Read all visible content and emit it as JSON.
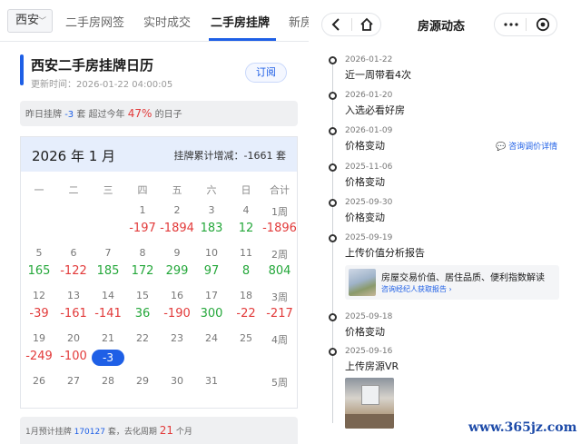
{
  "left": {
    "city": "西安",
    "nav_tabs": [
      "二手房网签",
      "实时成交",
      "二手房挂牌",
      "新房"
    ],
    "active_tab": "二手房挂牌",
    "page_title": "西安二手房挂牌日历",
    "update_time": "更新时间：2026-01-22 04:00:05",
    "subscribe_label": "订阅",
    "yesterday": {
      "prefix": "昨日挂牌",
      "value": "-3",
      "mid": "套 超过今年",
      "percent": "47%",
      "suffix": "的日子"
    },
    "calendar": {
      "month_label": "2026 年 1 月",
      "total_label": "挂牌累计增减：-1661 套",
      "weekdays": [
        "一",
        "二",
        "三",
        "四",
        "五",
        "六",
        "日",
        "合计"
      ],
      "rows": [
        {
          "days": [
            "",
            "",
            "",
            "1",
            "2",
            "3",
            "4"
          ],
          "week": "1周",
          "values": [
            "",
            "",
            "",
            "-197",
            "-1894",
            "183",
            "12"
          ],
          "total": "-1896"
        },
        {
          "days": [
            "5",
            "6",
            "7",
            "8",
            "9",
            "10",
            "11"
          ],
          "week": "2周",
          "values": [
            "165",
            "-122",
            "185",
            "172",
            "299",
            "97",
            "8"
          ],
          "total": "804"
        },
        {
          "days": [
            "12",
            "13",
            "14",
            "15",
            "16",
            "17",
            "18"
          ],
          "week": "3周",
          "values": [
            "-39",
            "-161",
            "-141",
            "36",
            "-190",
            "300",
            "-22"
          ],
          "total": "-217"
        },
        {
          "days": [
            "19",
            "20",
            "21",
            "22",
            "23",
            "24",
            "25"
          ],
          "week": "4周",
          "values": [
            "-249",
            "-100",
            "-3",
            "",
            "",
            "",
            ""
          ],
          "total": ""
        },
        {
          "days": [
            "26",
            "27",
            "28",
            "29",
            "30",
            "31",
            ""
          ],
          "week": "5周",
          "values": [
            "",
            "",
            "",
            "",
            "",
            "",
            ""
          ],
          "total": ""
        }
      ],
      "highlight": {
        "row": 3,
        "col": 2
      }
    },
    "footer": {
      "prefix": "1月预计挂牌",
      "value": "170127",
      "mid": "套，去化周期",
      "cycle": "21",
      "suffix": "个月"
    }
  },
  "right": {
    "title": "房源动态",
    "consult_link": "咨询调价详情",
    "events": [
      {
        "date": "2026-01-22",
        "text": "近一周带看4次"
      },
      {
        "date": "2026-01-20",
        "text": "入选必看好房"
      },
      {
        "date": "2026-01-09",
        "text": "价格变动"
      },
      {
        "date": "2025-11-06",
        "text": "价格变动"
      },
      {
        "date": "2025-09-30",
        "text": "价格变动"
      },
      {
        "date": "2025-09-19",
        "text": "上传价值分析报告"
      },
      {
        "date": "2025-09-18",
        "text": "价格变动"
      },
      {
        "date": "2025-09-16",
        "text": "上传房源VR"
      }
    ],
    "report": {
      "title": "房屋交易价值、居住品质、便利指数解读",
      "link": "咨询经纪人获取报告 ›"
    }
  },
  "watermark": "www.365jz.com",
  "colors": {
    "accent": "#1e5fe6",
    "increase": "#e23a3a",
    "decrease": "#24a73a"
  }
}
